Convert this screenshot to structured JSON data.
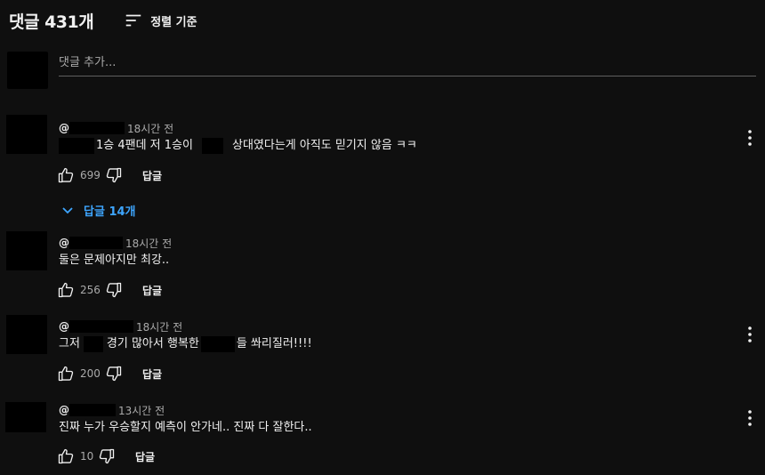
{
  "header": {
    "count": "댓글 431개",
    "sort_label": "정렬 기준"
  },
  "add_comment": {
    "placeholder": "댓글 추가..."
  },
  "comments": [
    {
      "at": "@",
      "time": "18시간 전",
      "text_a": "1승 4팬데 저 1승이",
      "text_b": "상대였다는게 아직도 믿기지 않음 ㅋㅋ",
      "likes": "699",
      "reply_label": "답글",
      "replies_toggle": "답글 14개"
    },
    {
      "at": "@",
      "time": "18시간 전",
      "text_a": "둘은 문제아지만 최강..",
      "likes": "256",
      "reply_label": "답글"
    },
    {
      "at": "@",
      "time": "18시간 전",
      "text_a": "그저",
      "text_b": "경기 많아서 행복한",
      "text_c": "들 쏴리질러!!!!",
      "likes": "200",
      "reply_label": "답글"
    },
    {
      "at": "@",
      "time": "13시간 전",
      "text_a": "진짜 누가 우승할지 예측이 안가네.. 진짜 다 잘한다..",
      "likes": "10",
      "reply_label": "답글"
    }
  ],
  "colors": {
    "background": "#0f0f0f",
    "text": "#f1f1f1",
    "muted": "#aaaaaa",
    "link": "#3ea6ff"
  },
  "icons": [
    "sort-icon",
    "thumbs-up-icon",
    "thumbs-down-icon",
    "more-vert-icon",
    "chevron-down-icon"
  ]
}
